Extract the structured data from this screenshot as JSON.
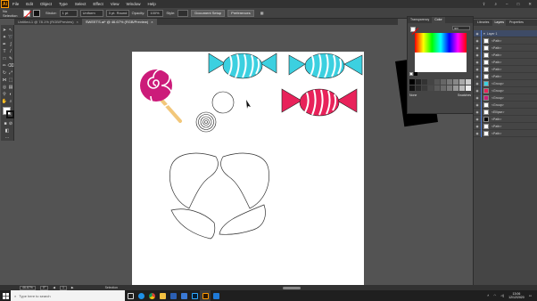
{
  "menu": {
    "app_logo": "Ai",
    "items": [
      "File",
      "Edit",
      "Object",
      "Type",
      "Select",
      "Effect",
      "View",
      "Window",
      "Help"
    ],
    "right_icons": [
      "share-icon",
      "search-icon",
      "minimize-icon",
      "maximize-icon",
      "close-icon"
    ]
  },
  "control_bar": {
    "selection_label": "No Selection",
    "stroke_label": "Stroke:",
    "stroke_value": "1 pt",
    "stroke_style": "Uniform",
    "brush_value": "3 pt. Round",
    "opacity_label": "Opacity:",
    "opacity_value": "100%",
    "style_label": "Style:",
    "document_setup": "Document Setup",
    "preferences": "Preferences"
  },
  "tabs": [
    {
      "label": "Untitled-1 @ 78.1% (RGB/Preview)",
      "close": "×",
      "active": false
    },
    {
      "label": "SWEETS.ai* @ 46.67% (RGB/Preview)",
      "close": "×",
      "active": true
    }
  ],
  "color_panel": {
    "tab_transparency": "Transparency",
    "tab_color": "Color",
    "hex": "ffffff",
    "footer_none": "None",
    "footer_label": "Swatches"
  },
  "layers_panel": {
    "tabs": [
      "Libraries",
      "Layers",
      "Properties"
    ],
    "layer_name": "Layer 1",
    "rows": [
      "<Path>",
      "<Path>",
      "<Path>",
      "<Path>",
      "<Path>",
      "<Path>",
      "<Group>",
      "<Group>",
      "<Group>",
      "<Group>",
      "<Ellipse>",
      "<Path>",
      "<Path>",
      "<Path>"
    ]
  },
  "status_bar": {
    "zoom": "46.67%",
    "angle": "0°",
    "artboard_number": "1",
    "tool": "Selection"
  },
  "taskbar": {
    "search_placeholder": "Type here to search",
    "time": "13:06",
    "date": "12/12/2020",
    "apps": [
      "task-view-icon",
      "edge-icon",
      "chrome-icon",
      "file-explorer-icon",
      "word-icon",
      "store-icon",
      "photoshop-icon",
      "illustrator-icon",
      "mail-icon"
    ]
  },
  "colors": {
    "candy_cyan": "#3cd0e0",
    "candy_pink": "#e8225a",
    "lollipop_pink": "#cc1b7a",
    "stick": "#f2c77a",
    "accent_orange": "#ff9a00"
  }
}
